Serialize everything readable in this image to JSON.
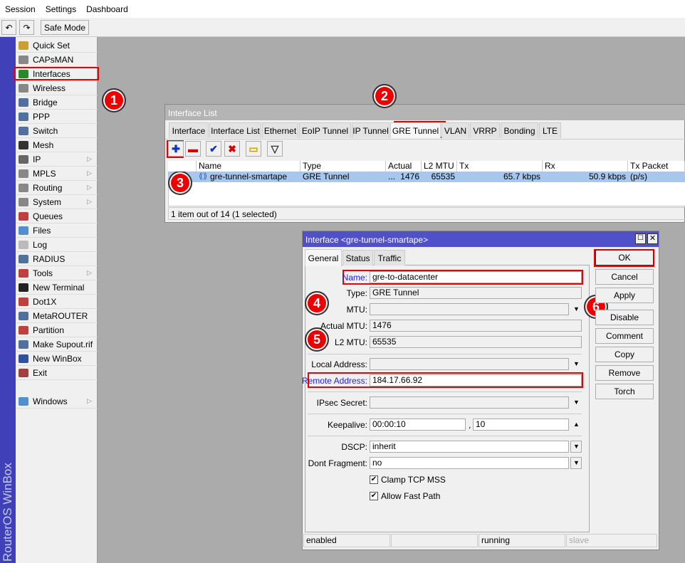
{
  "menu": [
    "Session",
    "Settings",
    "Dashboard"
  ],
  "toolbar": {
    "undo_icon": "undo-icon",
    "redo_icon": "redo-icon",
    "safe_mode": "Safe Mode"
  },
  "brand": "RouterOS WinBox",
  "sidebar": [
    {
      "label": "Quick Set",
      "color": "#c8a030"
    },
    {
      "label": "CAPsMAN",
      "color": "#888"
    },
    {
      "label": "Interfaces",
      "color": "#2a8a2a"
    },
    {
      "label": "Wireless",
      "color": "#888"
    },
    {
      "label": "Bridge",
      "color": "#5070a0"
    },
    {
      "label": "PPP",
      "color": "#5070a0"
    },
    {
      "label": "Switch",
      "color": "#5070a0"
    },
    {
      "label": "Mesh",
      "color": "#333"
    },
    {
      "label": "IP",
      "color": "#666",
      "sub": true
    },
    {
      "label": "MPLS",
      "color": "#888",
      "sub": true
    },
    {
      "label": "Routing",
      "color": "#888",
      "sub": true
    },
    {
      "label": "System",
      "color": "#888",
      "sub": true
    },
    {
      "label": "Queues",
      "color": "#c04040"
    },
    {
      "label": "Files",
      "color": "#5090d0"
    },
    {
      "label": "Log",
      "color": "#bbb"
    },
    {
      "label": "RADIUS",
      "color": "#5070a0"
    },
    {
      "label": "Tools",
      "color": "#c04040",
      "sub": true
    },
    {
      "label": "New Terminal",
      "color": "#222"
    },
    {
      "label": "Dot1X",
      "color": "#c04040"
    },
    {
      "label": "MetaROUTER",
      "color": "#5070a0"
    },
    {
      "label": "Partition",
      "color": "#c04040"
    },
    {
      "label": "Make Supout.rif",
      "color": "#5070a0"
    },
    {
      "label": "New WinBox",
      "color": "#3050a0"
    },
    {
      "label": "Exit",
      "color": "#a04040"
    },
    {
      "label": "Windows",
      "color": "#5090d0",
      "sub": true
    }
  ],
  "iflist": {
    "title": "Interface List",
    "tabs": [
      "Interface",
      "Interface List",
      "Ethernet",
      "EoIP Tunnel",
      "IP Tunnel",
      "GRE Tunnel",
      "VLAN",
      "VRRP",
      "Bonding",
      "LTE"
    ],
    "active_tab": "GRE Tunnel",
    "buttons": [
      {
        "icon": "plus-icon",
        "glyph": "✚",
        "color": "#1030c0"
      },
      {
        "icon": "minus-icon",
        "glyph": "▬",
        "color": "#d00"
      },
      {
        "icon": "check-icon",
        "glyph": "✔",
        "color": "#1030c0"
      },
      {
        "icon": "cross-icon",
        "glyph": "✖",
        "color": "#d00"
      },
      {
        "icon": "comment-icon",
        "glyph": "▭",
        "color": "#c0a000"
      },
      {
        "icon": "filter-icon",
        "glyph": "▽",
        "color": "#333"
      }
    ],
    "columns": [
      "Name",
      "Type",
      "Actual ...",
      "L2 MTU",
      "Tx",
      "Rx",
      "Tx Packet (p/s)"
    ],
    "rows": [
      {
        "name": "gre-tunnel-smartape",
        "type": "GRE Tunnel",
        "actual_mtu": "1476",
        "l2_mtu": "65535",
        "tx": "65.7 kbps",
        "rx": "50.9 kbps",
        "tx_packet": ""
      }
    ],
    "status": "1 item out of 14 (1 selected)"
  },
  "dialog": {
    "title": "Interface <gre-tunnel-smartape>",
    "tabs": [
      "General",
      "Status",
      "Traffic"
    ],
    "fields": {
      "name": {
        "label": "Name:",
        "value": "gre-to-datacenter"
      },
      "type": {
        "label": "Type:",
        "value": "GRE Tunnel"
      },
      "mtu": {
        "label": "MTU:",
        "value": ""
      },
      "actual_mtu": {
        "label": "Actual MTU:",
        "value": "1476"
      },
      "l2_mtu": {
        "label": "L2 MTU:",
        "value": "65535"
      },
      "local_address": {
        "label": "Local Address:",
        "value": ""
      },
      "remote_address": {
        "label": "Remote Address:",
        "value": "184.17.66.92"
      },
      "ipsec_secret": {
        "label": "IPsec Secret:",
        "value": ""
      },
      "keepalive": {
        "label": "Keepalive:",
        "value": "00:00:10",
        "value2": "10",
        "sep": ","
      },
      "dscp": {
        "label": "DSCP:",
        "value": "inherit"
      },
      "dont_fragment": {
        "label": "Dont Fragment:",
        "value": "no"
      }
    },
    "checkboxes": [
      {
        "label": "Clamp TCP MSS",
        "checked": true
      },
      {
        "label": "Allow Fast Path",
        "checked": true
      }
    ],
    "buttons": [
      "OK",
      "Cancel",
      "Apply",
      "Disable",
      "Comment",
      "Copy",
      "Remove",
      "Torch"
    ],
    "status": [
      "enabled",
      "",
      "running",
      "slave"
    ]
  },
  "annotations": [
    "1",
    "2",
    "3",
    "4",
    "5",
    "6"
  ],
  "colors": {
    "annotation": "#e00000",
    "title_active": "#5050c8",
    "selected_row": "#a6c8ee",
    "link_label": "#2020e0"
  }
}
